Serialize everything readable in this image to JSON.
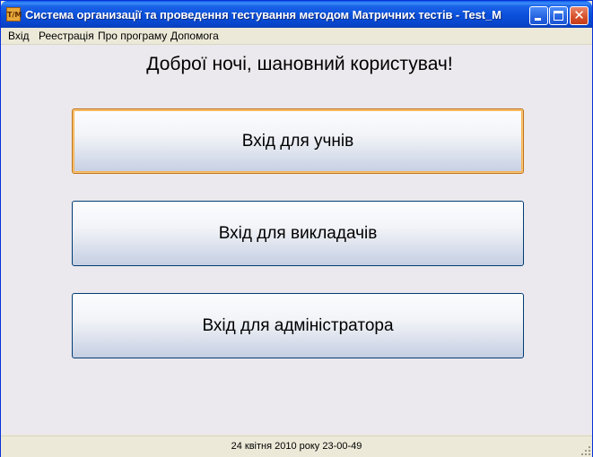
{
  "window": {
    "title": "Система организації та проведення тестування методом Матричних тестів - Test_M",
    "icon_label": "T/M",
    "controls": [
      "minimize-icon",
      "maximize-icon",
      "close-icon"
    ]
  },
  "menu": {
    "items": [
      {
        "label": "Вхід"
      },
      {
        "label": "Реестрація"
      },
      {
        "label": "Про програму"
      },
      {
        "label": "Допомога"
      }
    ]
  },
  "main": {
    "greeting": "Доброї ночі, шановний користувач!",
    "buttons": [
      {
        "label": "Вхід для учнів",
        "focused": true
      },
      {
        "label": "Вхід для викладачів"
      },
      {
        "label": "Вхід для адміністратора"
      }
    ]
  },
  "status": {
    "datetime": "24 квітня 2010 року 23-00-49"
  },
  "colors": {
    "titlebar": "#0a4fd9",
    "window_bg": "#ece9d8",
    "content_bg": "#ebe9ed",
    "button_border": "#003c74",
    "focus_border": "#c0721a"
  }
}
